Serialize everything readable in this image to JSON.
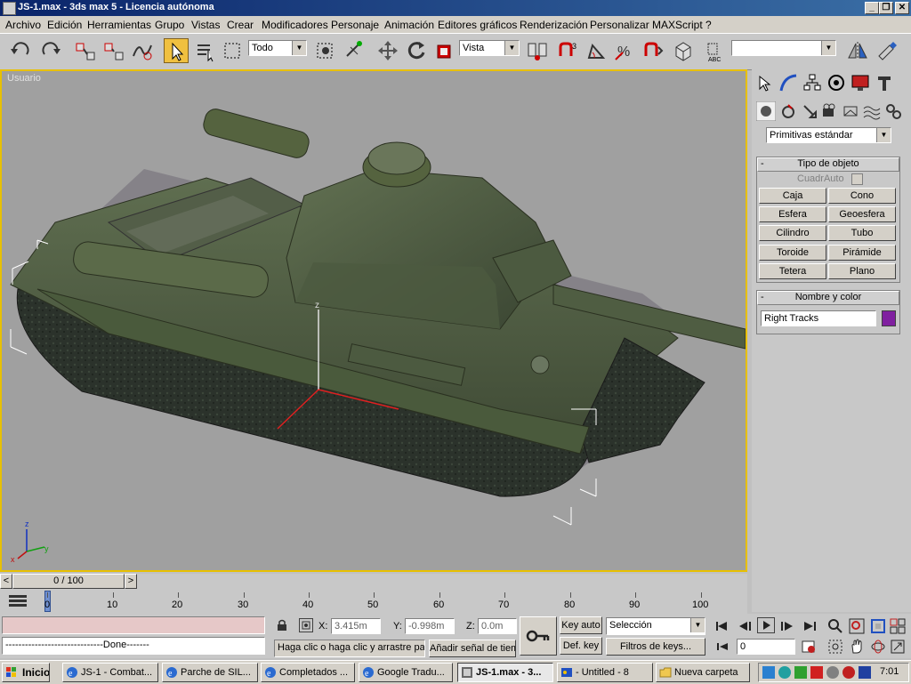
{
  "window": {
    "title": "JS-1.max - 3ds max 5 - Licencia autónoma",
    "controls": [
      "_",
      "❐",
      "✕"
    ]
  },
  "menu": [
    "Archivo",
    "Edición",
    "Herramientas",
    "Grupo",
    "Vistas",
    "Crear",
    "Modificadores",
    "Personaje",
    "Animación",
    "Editores gráficos",
    "Renderización",
    "Personalizar",
    "MAXScript",
    "?"
  ],
  "toolbar": {
    "selection_filter": "Todo",
    "reference_coord": "Vista",
    "named_selection": ""
  },
  "viewport": {
    "label": "Usuario",
    "axis_labels": {
      "x": "x",
      "y": "y",
      "z": "z"
    },
    "gizmo_z": "z"
  },
  "command_panel": {
    "category_dropdown": "Primitivas estándar",
    "object_type": {
      "header": "Tipo de objeto",
      "autogrid_label": "CuadrAuto",
      "buttons": [
        "Caja",
        "Cono",
        "Esfera",
        "Geoesfera",
        "Cilindro",
        "Tubo",
        "Toroide",
        "Pirámide",
        "Tetera",
        "Plano"
      ]
    },
    "name_color": {
      "header": "Nombre y color",
      "name_value": "Right Tracks",
      "color": "#8020a0"
    }
  },
  "timeline": {
    "frame_display": "0 / 100",
    "ticks": [
      "0",
      "10",
      "20",
      "30",
      "40",
      "50",
      "60",
      "70",
      "80",
      "90",
      "100"
    ],
    "slider_prev": "<",
    "slider_next": ">"
  },
  "status": {
    "script_output": "------------------------------Done-------",
    "prompt": "Haga clic o haga clic y arrastre par",
    "add_time_tag": "Añadir señal de tiem",
    "x_label": "X:",
    "x_value": "3.415m",
    "y_label": "Y:",
    "y_value": "-0.998m",
    "z_label": "Z:",
    "z_value": "0.0m",
    "key_auto": "Key auto",
    "key_set": "Def. key",
    "key_mode_select": "Selección",
    "key_filters": "Filtros de keys...",
    "current_frame": "0"
  },
  "taskbar": {
    "start": "Inicio",
    "tasks": [
      "JS-1 - Combat...",
      "Parche de SIL...",
      "Completados ...",
      "Google Tradu...",
      "JS-1.max - 3...",
      "- Untitled - 8",
      "Nueva carpeta"
    ],
    "clock": "7:01"
  },
  "colors": {
    "viewport_bg": "#a0a0a0",
    "active_viewport_border": "#e8c000",
    "tank_green": "#4a5a3c",
    "tracks_dark": "#2a302a"
  }
}
